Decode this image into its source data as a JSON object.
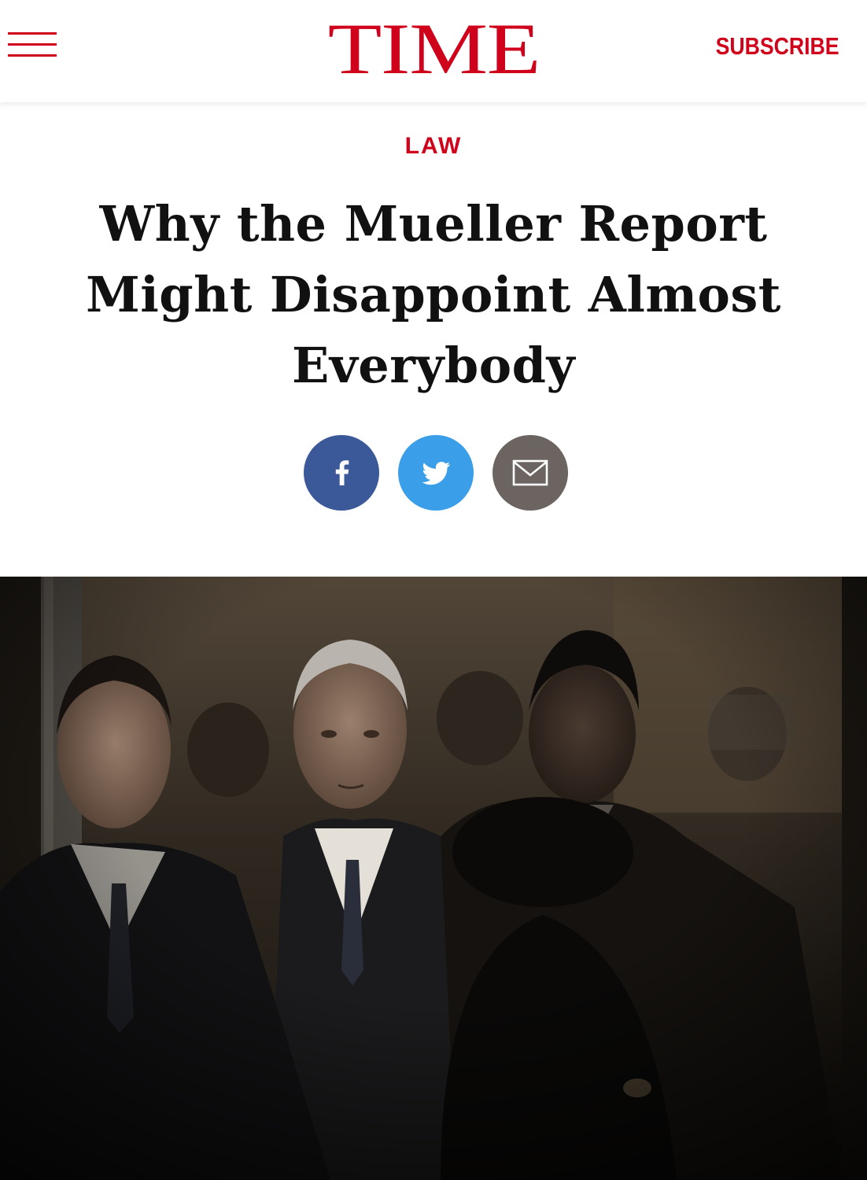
{
  "header": {
    "logo": "TIME",
    "subscribe_label": "SUBSCRIBE",
    "menu_icon": "hamburger-menu-icon"
  },
  "article": {
    "section": "LAW",
    "title": "Why the Mueller Report Might Disappoint Almost Everybody"
  },
  "share": [
    {
      "name": "facebook",
      "icon": "facebook-icon",
      "color": "#3b5998"
    },
    {
      "name": "twitter",
      "icon": "twitter-icon",
      "color": "#3b9ee8"
    },
    {
      "name": "email",
      "icon": "envelope-icon",
      "color": "#6b6460"
    }
  ],
  "colors": {
    "brand": "#d0021b",
    "headline": "#111111"
  }
}
